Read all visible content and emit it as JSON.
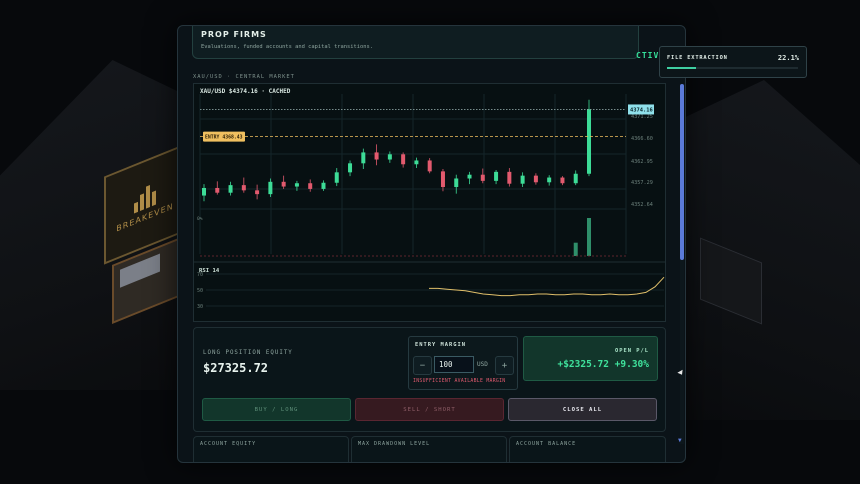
{
  "header": {
    "title": "PROP FIRMS",
    "subtitle": "Evaluations, funded accounts and capital transitions.",
    "active_tag": "CTIVE"
  },
  "market_label": "XAU/USD · CENTRAL MARKET",
  "chart_head": "XAU/USD  $4374.16  ·  CACHED",
  "scene": {
    "sign_text": "BREAKEVEN"
  },
  "chart_data": {
    "type": "candlestick",
    "symbol": "XAU/USD",
    "last_price": 4374.16,
    "entry_label": "ENTRY 4368.43",
    "entry_price": 4368.43,
    "price_ticks": [
      "4374.16",
      "4371.25",
      "4366.60",
      "4362.95",
      "4357.29",
      "4352.64"
    ],
    "ylim": [
      4350,
      4377
    ],
    "volume_label": "0%",
    "colors": {
      "up": "#3ddc97",
      "down": "#e25a6e",
      "entry": "#f0c060",
      "last": "#9fe8f0"
    },
    "candles": [
      {
        "o": 4356.0,
        "h": 4358.4,
        "l": 4354.8,
        "c": 4357.6
      },
      {
        "o": 4357.6,
        "h": 4359.0,
        "l": 4356.2,
        "c": 4356.6
      },
      {
        "o": 4356.6,
        "h": 4358.9,
        "l": 4356.0,
        "c": 4358.2
      },
      {
        "o": 4358.2,
        "h": 4359.8,
        "l": 4356.6,
        "c": 4357.1
      },
      {
        "o": 4357.1,
        "h": 4358.3,
        "l": 4355.2,
        "c": 4356.3
      },
      {
        "o": 4356.3,
        "h": 4359.6,
        "l": 4355.7,
        "c": 4358.9
      },
      {
        "o": 4358.9,
        "h": 4360.2,
        "l": 4357.4,
        "c": 4357.9
      },
      {
        "o": 4357.9,
        "h": 4359.1,
        "l": 4357.0,
        "c": 4358.6
      },
      {
        "o": 4358.6,
        "h": 4359.4,
        "l": 4356.8,
        "c": 4357.4
      },
      {
        "o": 4357.4,
        "h": 4359.2,
        "l": 4357.0,
        "c": 4358.7
      },
      {
        "o": 4358.7,
        "h": 4361.8,
        "l": 4358.0,
        "c": 4360.9
      },
      {
        "o": 4360.9,
        "h": 4363.4,
        "l": 4360.1,
        "c": 4362.8
      },
      {
        "o": 4362.8,
        "h": 4365.9,
        "l": 4361.6,
        "c": 4365.1
      },
      {
        "o": 4365.1,
        "h": 4366.8,
        "l": 4362.4,
        "c": 4363.6
      },
      {
        "o": 4363.6,
        "h": 4365.3,
        "l": 4362.9,
        "c": 4364.7
      },
      {
        "o": 4364.7,
        "h": 4365.1,
        "l": 4361.9,
        "c": 4362.6
      },
      {
        "o": 4362.6,
        "h": 4364.0,
        "l": 4361.8,
        "c": 4363.4
      },
      {
        "o": 4363.4,
        "h": 4363.9,
        "l": 4360.7,
        "c": 4361.1
      },
      {
        "o": 4361.1,
        "h": 4361.6,
        "l": 4356.9,
        "c": 4357.8
      },
      {
        "o": 4357.8,
        "h": 4360.4,
        "l": 4356.4,
        "c": 4359.6
      },
      {
        "o": 4359.6,
        "h": 4361.0,
        "l": 4358.4,
        "c": 4360.4
      },
      {
        "o": 4360.4,
        "h": 4361.7,
        "l": 4358.6,
        "c": 4359.1
      },
      {
        "o": 4359.1,
        "h": 4361.4,
        "l": 4358.4,
        "c": 4361.0
      },
      {
        "o": 4361.0,
        "h": 4361.8,
        "l": 4357.9,
        "c": 4358.5
      },
      {
        "o": 4358.5,
        "h": 4360.9,
        "l": 4357.8,
        "c": 4360.2
      },
      {
        "o": 4360.2,
        "h": 4360.7,
        "l": 4358.3,
        "c": 4358.8
      },
      {
        "o": 4358.8,
        "h": 4360.3,
        "l": 4358.1,
        "c": 4359.8
      },
      {
        "o": 4359.8,
        "h": 4360.1,
        "l": 4358.2,
        "c": 4358.6
      },
      {
        "o": 4358.6,
        "h": 4361.3,
        "l": 4358.2,
        "c": 4360.6
      },
      {
        "o": 4360.6,
        "h": 4376.2,
        "l": 4360.1,
        "c": 4374.2
      }
    ],
    "volumes": [
      0,
      0,
      0,
      0,
      0,
      0,
      0,
      0,
      0,
      0,
      0,
      0,
      0,
      0,
      0,
      0,
      0,
      0,
      0,
      0,
      0,
      0,
      0,
      0,
      0,
      0,
      0,
      0,
      0.35,
      1.0
    ],
    "rsi": {
      "label": "RSI 14",
      "levels": [
        "70",
        "50",
        "30"
      ],
      "values": [
        52,
        52,
        51,
        50,
        49,
        47,
        45,
        44,
        43,
        43,
        44,
        44,
        45,
        45,
        44,
        44,
        45,
        45,
        44,
        44,
        45,
        44,
        44,
        45,
        47,
        54,
        66
      ]
    }
  },
  "panel": {
    "equity_label": "LONG POSITION EQUITY",
    "equity_value": "$27325.72",
    "margin_label": "ENTRY MARGIN",
    "margin_minus": "−",
    "margin_value": "100",
    "margin_unit": "USD",
    "margin_plus": "+",
    "margin_warning": "INSUFFICIENT AVAILABLE MARGIN",
    "pnl_label": "OPEN P/L",
    "pnl_value": "+$2325.72 +9.30%",
    "buy_label": "BUY / LONG",
    "sell_label": "SELL / SHORT",
    "close_label": "CLOSE ALL"
  },
  "stats": [
    {
      "label": "ACCOUNT EQUITY"
    },
    {
      "label": "MAX DRAWDOWN LEVEL"
    },
    {
      "label": "ACCOUNT BALANCE"
    }
  ],
  "extraction": {
    "label": "FILE EXTRACTION",
    "percent_text": "22.1%",
    "progress": 0.221
  },
  "icons": {
    "scroll_down": "▼"
  }
}
